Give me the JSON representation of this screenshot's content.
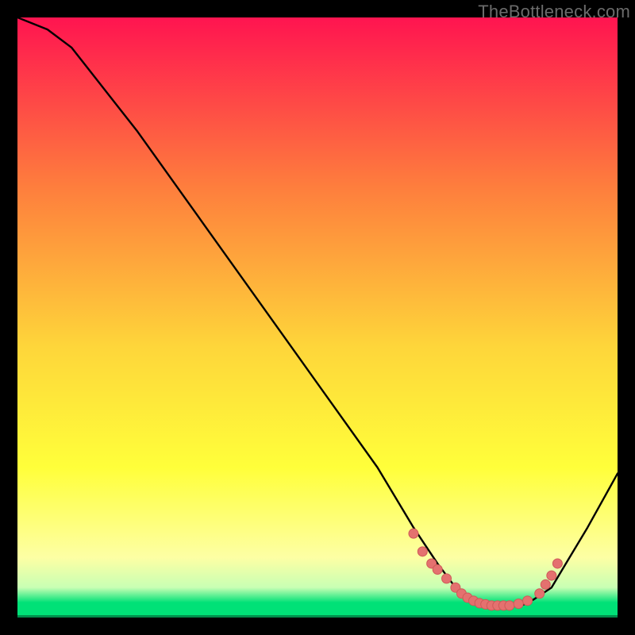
{
  "watermark": "TheBottleneck.com",
  "colors": {
    "top": "#ff1450",
    "mid1": "#fe7d3d",
    "mid2": "#fed63a",
    "mid3": "#ffff3a",
    "low1": "#fdffa4",
    "low2": "#c8ffb4",
    "bottom_band": "#00e177",
    "bottom_edge": "#008e4c",
    "curve": "#000000",
    "marker_fill": "#e4716f",
    "marker_stroke": "#cf5a58"
  },
  "chart_data": {
    "type": "line",
    "title": "",
    "xlabel": "",
    "ylabel": "",
    "xlim": [
      0,
      100
    ],
    "ylim": [
      0,
      100
    ],
    "curve": {
      "x": [
        0,
        5,
        9,
        20,
        30,
        40,
        50,
        60,
        66,
        68,
        70,
        73,
        76,
        79,
        82,
        84,
        86,
        89,
        92,
        95,
        100
      ],
      "y": [
        100,
        98,
        95,
        81,
        67,
        53,
        39,
        25,
        15,
        12,
        9,
        5,
        3,
        2,
        2,
        2,
        3,
        5,
        10,
        15,
        24
      ]
    },
    "markers": {
      "x": [
        66,
        67.5,
        69,
        70,
        71.5,
        73,
        74,
        75,
        76,
        77,
        78,
        79,
        80,
        81,
        82,
        83.5,
        85,
        87,
        88,
        89,
        90
      ],
      "y": [
        14,
        11,
        9,
        8,
        6.5,
        5,
        4,
        3.3,
        2.8,
        2.4,
        2.2,
        2,
        2,
        2,
        2,
        2.3,
        2.8,
        4,
        5.5,
        7,
        9
      ]
    }
  }
}
